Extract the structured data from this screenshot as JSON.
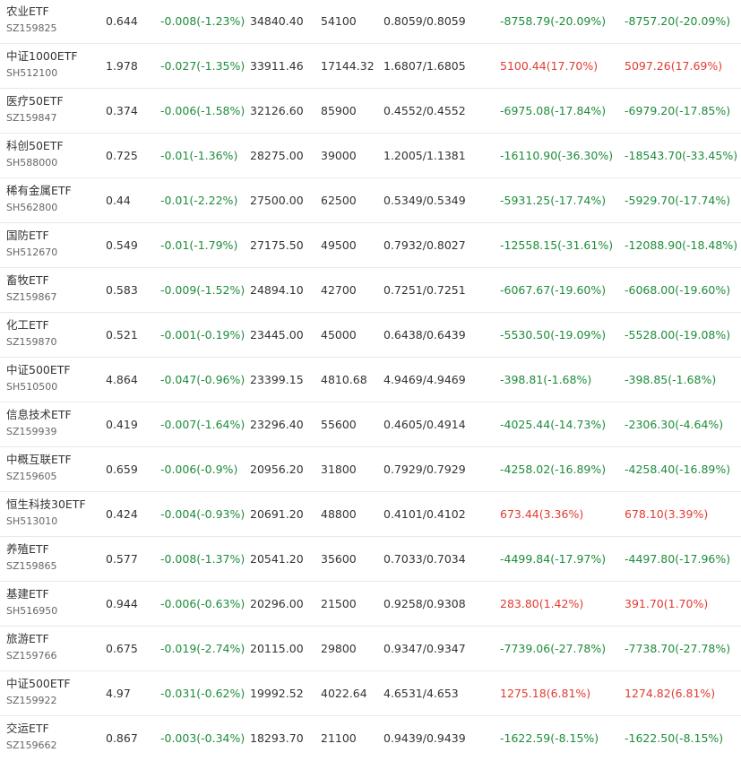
{
  "colors": {
    "up": "#e03c31",
    "down": "#1e8c3b",
    "neutral": "#333333",
    "divider": "#e8e8e8"
  },
  "rows": [
    {
      "name": "农业ETF",
      "code": "SZ159825",
      "price": "0.644",
      "change": "-0.008(-1.23%)",
      "amount": "34840.40",
      "volume": "54100",
      "nav": "0.8059/0.8059",
      "pl1": "-8758.79(-20.09%)",
      "pl1_dir": "down",
      "pl2": "-8757.20(-20.09%)",
      "pl2_dir": "down"
    },
    {
      "name": "中证1000ETF",
      "code": "SH512100",
      "price": "1.978",
      "change": "-0.027(-1.35%)",
      "amount": "33911.46",
      "volume": "17144.32",
      "nav": "1.6807/1.6805",
      "pl1": "5100.44(17.70%)",
      "pl1_dir": "up",
      "pl2": "5097.26(17.69%)",
      "pl2_dir": "up"
    },
    {
      "name": "医疗50ETF",
      "code": "SZ159847",
      "price": "0.374",
      "change": "-0.006(-1.58%)",
      "amount": "32126.60",
      "volume": "85900",
      "nav": "0.4552/0.4552",
      "pl1": "-6975.08(-17.84%)",
      "pl1_dir": "down",
      "pl2": "-6979.20(-17.85%)",
      "pl2_dir": "down"
    },
    {
      "name": "科创50ETF",
      "code": "SH588000",
      "price": "0.725",
      "change": "-0.01(-1.36%)",
      "amount": "28275.00",
      "volume": "39000",
      "nav": "1.2005/1.1381",
      "pl1": "-16110.90(-36.30%)",
      "pl1_dir": "down",
      "pl2": "-18543.70(-33.45%)",
      "pl2_dir": "down"
    },
    {
      "name": "稀有金属ETF",
      "code": "SH562800",
      "price": "0.44",
      "change": "-0.01(-2.22%)",
      "amount": "27500.00",
      "volume": "62500",
      "nav": "0.5349/0.5349",
      "pl1": "-5931.25(-17.74%)",
      "pl1_dir": "down",
      "pl2": "-5929.70(-17.74%)",
      "pl2_dir": "down"
    },
    {
      "name": "国防ETF",
      "code": "SH512670",
      "price": "0.549",
      "change": "-0.01(-1.79%)",
      "amount": "27175.50",
      "volume": "49500",
      "nav": "0.7932/0.8027",
      "pl1": "-12558.15(-31.61%)",
      "pl1_dir": "down",
      "pl2": "-12088.90(-18.48%)",
      "pl2_dir": "down"
    },
    {
      "name": "畜牧ETF",
      "code": "SZ159867",
      "price": "0.583",
      "change": "-0.009(-1.52%)",
      "amount": "24894.10",
      "volume": "42700",
      "nav": "0.7251/0.7251",
      "pl1": "-6067.67(-19.60%)",
      "pl1_dir": "down",
      "pl2": "-6068.00(-19.60%)",
      "pl2_dir": "down"
    },
    {
      "name": "化工ETF",
      "code": "SZ159870",
      "price": "0.521",
      "change": "-0.001(-0.19%)",
      "amount": "23445.00",
      "volume": "45000",
      "nav": "0.6438/0.6439",
      "pl1": "-5530.50(-19.09%)",
      "pl1_dir": "down",
      "pl2": "-5528.00(-19.08%)",
      "pl2_dir": "down"
    },
    {
      "name": "中证500ETF",
      "code": "SH510500",
      "price": "4.864",
      "change": "-0.047(-0.96%)",
      "amount": "23399.15",
      "volume": "4810.68",
      "nav": "4.9469/4.9469",
      "pl1": "-398.81(-1.68%)",
      "pl1_dir": "down",
      "pl2": "-398.85(-1.68%)",
      "pl2_dir": "down"
    },
    {
      "name": "信息技术ETF",
      "code": "SZ159939",
      "price": "0.419",
      "change": "-0.007(-1.64%)",
      "amount": "23296.40",
      "volume": "55600",
      "nav": "0.4605/0.4914",
      "pl1": "-4025.44(-14.73%)",
      "pl1_dir": "down",
      "pl2": "-2306.30(-4.64%)",
      "pl2_dir": "down"
    },
    {
      "name": "中概互联ETF",
      "code": "SZ159605",
      "price": "0.659",
      "change": "-0.006(-0.9%)",
      "amount": "20956.20",
      "volume": "31800",
      "nav": "0.7929/0.7929",
      "pl1": "-4258.02(-16.89%)",
      "pl1_dir": "down",
      "pl2": "-4258.40(-16.89%)",
      "pl2_dir": "down"
    },
    {
      "name": "恒生科技30ETF",
      "code": "SH513010",
      "price": "0.424",
      "change": "-0.004(-0.93%)",
      "amount": "20691.20",
      "volume": "48800",
      "nav": "0.4101/0.4102",
      "pl1": "673.44(3.36%)",
      "pl1_dir": "up",
      "pl2": "678.10(3.39%)",
      "pl2_dir": "up"
    },
    {
      "name": "养殖ETF",
      "code": "SZ159865",
      "price": "0.577",
      "change": "-0.008(-1.37%)",
      "amount": "20541.20",
      "volume": "35600",
      "nav": "0.7033/0.7034",
      "pl1": "-4499.84(-17.97%)",
      "pl1_dir": "down",
      "pl2": "-4497.80(-17.96%)",
      "pl2_dir": "down"
    },
    {
      "name": "基建ETF",
      "code": "SH516950",
      "price": "0.944",
      "change": "-0.006(-0.63%)",
      "amount": "20296.00",
      "volume": "21500",
      "nav": "0.9258/0.9308",
      "pl1": "283.80(1.42%)",
      "pl1_dir": "up",
      "pl2": "391.70(1.70%)",
      "pl2_dir": "up"
    },
    {
      "name": "旅游ETF",
      "code": "SZ159766",
      "price": "0.675",
      "change": "-0.019(-2.74%)",
      "amount": "20115.00",
      "volume": "29800",
      "nav": "0.9347/0.9347",
      "pl1": "-7739.06(-27.78%)",
      "pl1_dir": "down",
      "pl2": "-7738.70(-27.78%)",
      "pl2_dir": "down"
    },
    {
      "name": "中证500ETF",
      "code": "SZ159922",
      "price": "4.97",
      "change": "-0.031(-0.62%)",
      "amount": "19992.52",
      "volume": "4022.64",
      "nav": "4.6531/4.653",
      "pl1": "1275.18(6.81%)",
      "pl1_dir": "up",
      "pl2": "1274.82(6.81%)",
      "pl2_dir": "up"
    },
    {
      "name": "交运ETF",
      "code": "SZ159662",
      "price": "0.867",
      "change": "-0.003(-0.34%)",
      "amount": "18293.70",
      "volume": "21100",
      "nav": "0.9439/0.9439",
      "pl1": "-1622.59(-8.15%)",
      "pl1_dir": "down",
      "pl2": "-1622.50(-8.15%)",
      "pl2_dir": "down"
    }
  ]
}
